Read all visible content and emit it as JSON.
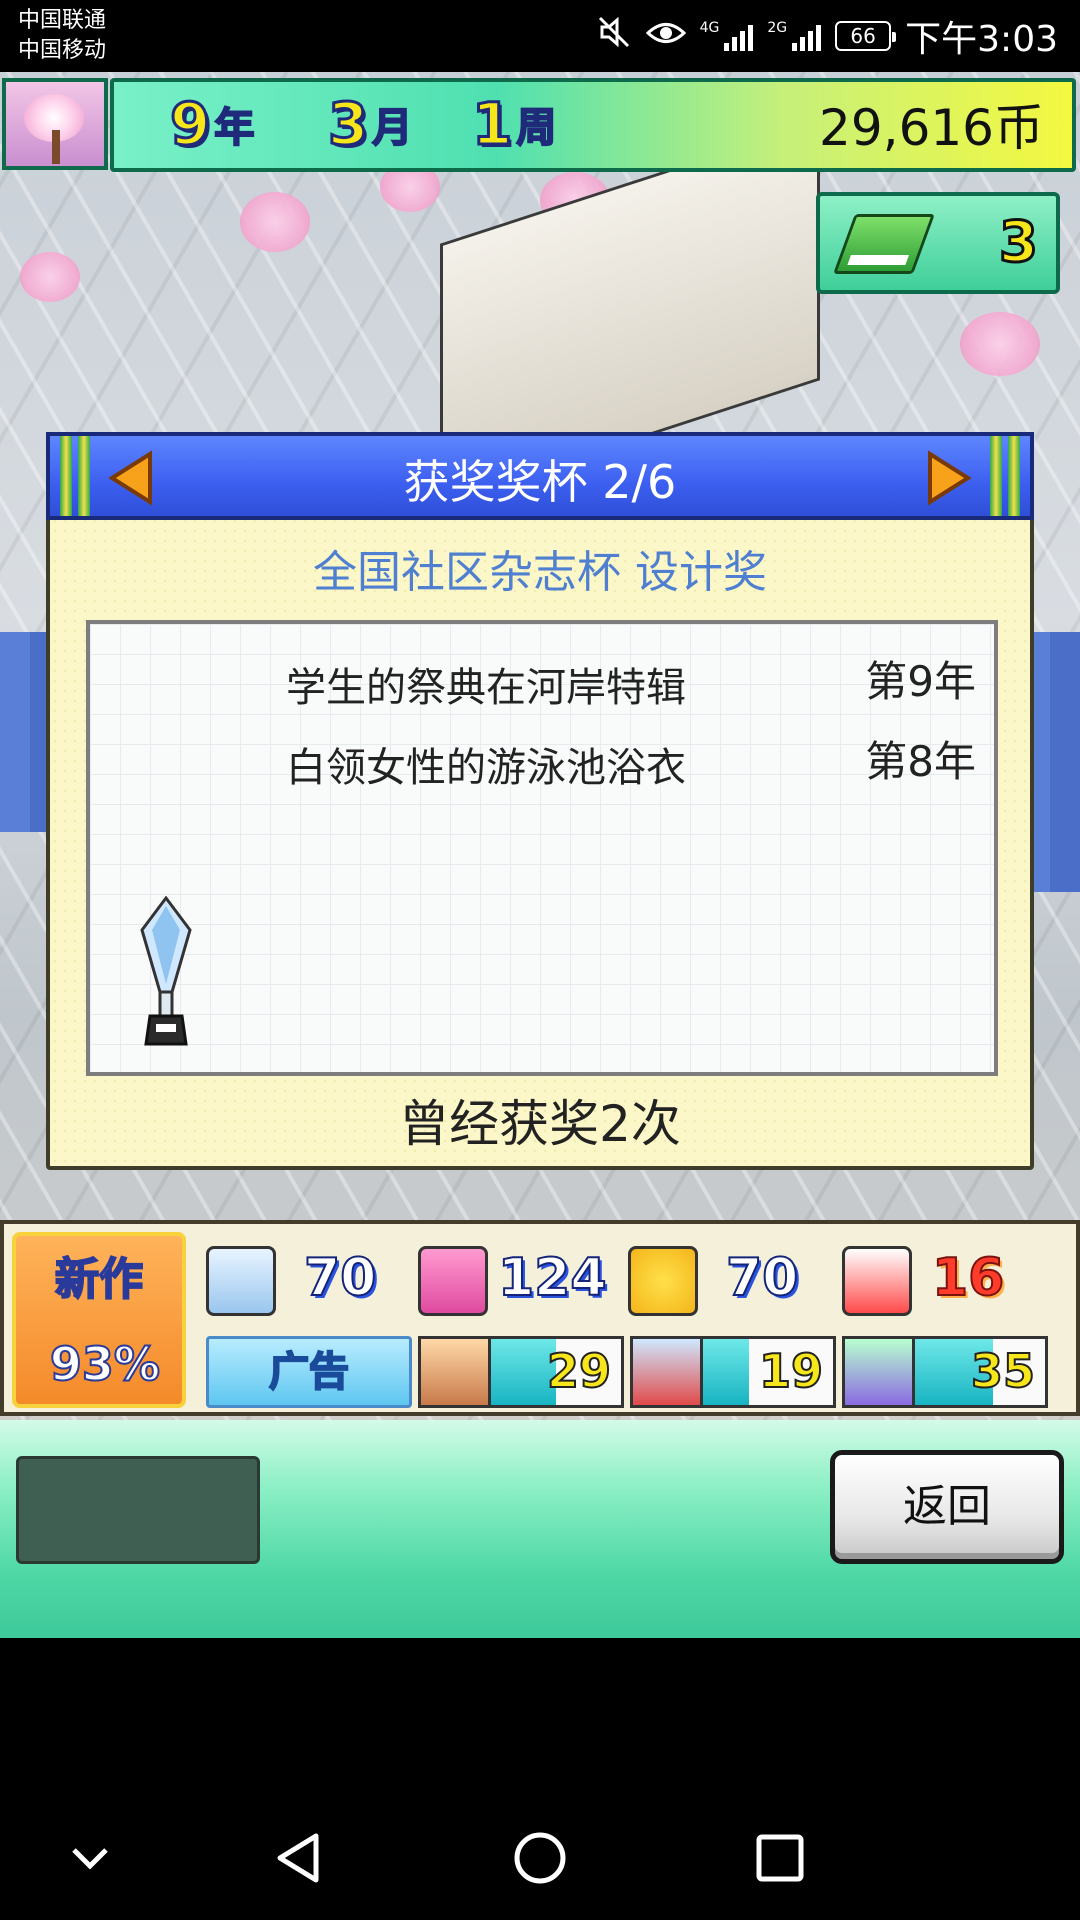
{
  "status_bar": {
    "carrier_1": "中国联通",
    "carrier_2": "中国移动",
    "net_1": "4G",
    "net_2": "2G",
    "battery": "66",
    "time": "下午3:03"
  },
  "top_bar": {
    "year": "9",
    "year_unit": "年",
    "month": "3",
    "month_unit": "月",
    "week": "1",
    "week_unit": "周",
    "money": "29,616币"
  },
  "book_count": "3",
  "dialog": {
    "title": "获奖奖杯 2/6",
    "award_name": "全国社区杂志杯 设计奖",
    "entries": [
      {
        "title": "学生的祭典在河岸特辑",
        "year": "第9年"
      },
      {
        "title": "白领女性的游泳池浴衣",
        "year": "第8年"
      }
    ],
    "summary": "曾经获奖2次"
  },
  "stats": {
    "new_work_label": "新作",
    "new_work_progress": "93%",
    "stat_1": "70",
    "stat_2": "124",
    "stat_3": "70",
    "stat_4": "16",
    "ad_label": "广告",
    "meter_1": "29",
    "meter_1_level": 0.5,
    "meter_2": "19",
    "meter_2_level": 0.35,
    "meter_3": "35",
    "meter_3_level": 0.6
  },
  "buttons": {
    "back": "返回"
  },
  "colors": {
    "dialog_header": "#3c5ff0",
    "award_name": "#4f7fd0",
    "bottom_bar": "#4fd8a6"
  }
}
